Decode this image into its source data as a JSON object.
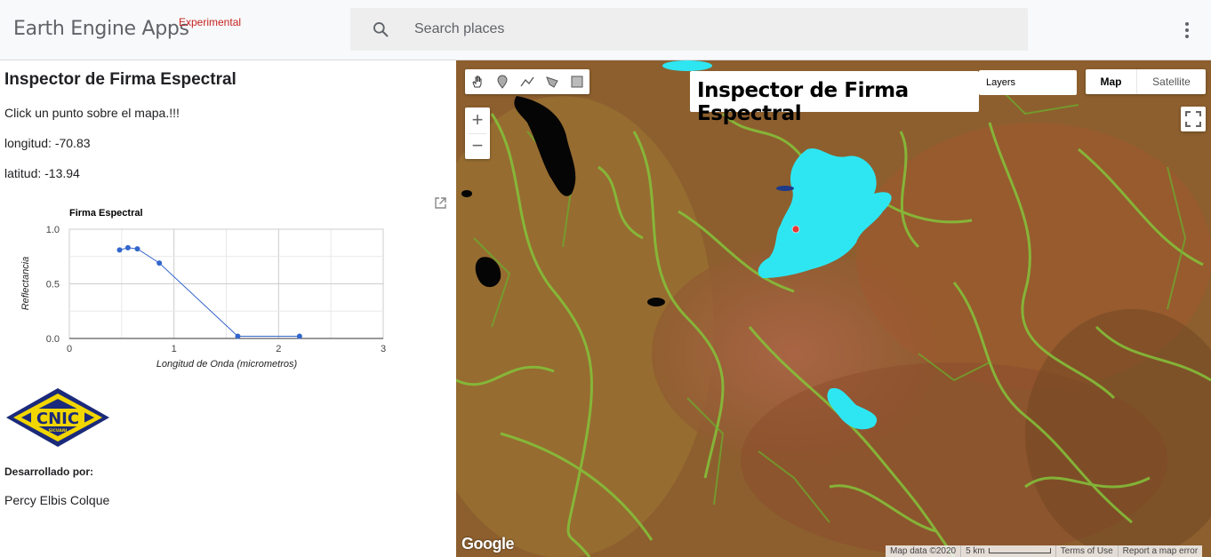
{
  "header": {
    "brand": "Earth Engine Apps",
    "badge": "Experimental",
    "search_placeholder": "Search places"
  },
  "panel": {
    "title": "Inspector de Firma Espectral",
    "instruction": "Click un punto sobre el mapa.!!!",
    "longitude": "longitud: -70.83",
    "latitude": "latitud: -13.94",
    "developed_by_label": "Desarrollado por:",
    "developer_name": "Percy Elbis Colque",
    "logo_text": "CNIC",
    "logo_subtext": "SICUANI"
  },
  "chart_data": {
    "type": "line",
    "title": "Firma Espectral",
    "xlabel": "Longitud de Onda (micrometros)",
    "ylabel": "Reflectancia",
    "xlim": [
      0,
      3
    ],
    "ylim": [
      0,
      1
    ],
    "x_ticks": [
      "0",
      "1",
      "2",
      "3"
    ],
    "y_ticks": [
      "0.0",
      "0.5",
      "1.0"
    ],
    "series": [
      {
        "color": "#3366cc",
        "points": [
          {
            "x": 0.48,
            "y": 0.81
          },
          {
            "x": 0.56,
            "y": 0.83
          },
          {
            "x": 0.65,
            "y": 0.82
          },
          {
            "x": 0.86,
            "y": 0.69
          },
          {
            "x": 1.61,
            "y": 0.02
          },
          {
            "x": 2.2,
            "y": 0.02
          }
        ]
      }
    ],
    "grid": true,
    "legend": "none"
  },
  "map": {
    "title": "Inspector de Firma Espectral",
    "layers_label": "Layers",
    "map_type_map": "Map",
    "map_type_satellite": "Satellite",
    "zoom_in": "+",
    "zoom_out": "−",
    "google_logo": "Google",
    "footer": {
      "map_data": "Map data ©2020",
      "scale": "5 km",
      "terms": "Terms of Use",
      "report": "Report a map error"
    },
    "colors": {
      "terrain": "#8a5a2c",
      "vegetation": "#7fbf3a",
      "glacier": "#2ee6f2",
      "water": "#000000",
      "marker": "#e53935"
    }
  }
}
